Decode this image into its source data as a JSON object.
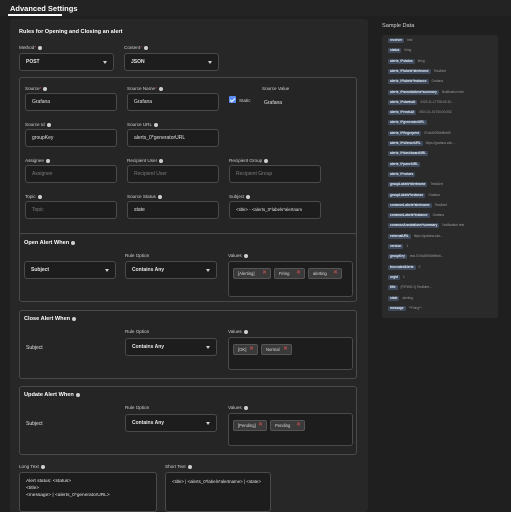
{
  "header": {
    "title": "Advanced Settings"
  },
  "rules": {
    "title": "Rules for Opening and Closing an alert",
    "method_label": "Method",
    "method_value": "POST",
    "content_label": "Content",
    "content_value": "JSON",
    "source_label": "Source",
    "source_value": "Grafana",
    "source_name_label": "Source Name",
    "source_name_value": "Grafana",
    "static_label": "Static",
    "source_value_label": "Source Value",
    "source_value_value": "Grafana",
    "source_id_label": "Source Id",
    "source_id_value": "groupKey",
    "source_url_label": "Source URL",
    "source_url_value": "alerts_0*generatorURL",
    "assignee_label": "Assignee",
    "assignee_placeholder": "Assignee",
    "recipient_user_label": "Recipient User",
    "recipient_user_placeholder": "Recipient User",
    "recipient_group_label": "Recipient Group",
    "recipient_group_placeholder": "Recipient Group",
    "topic_label": "Topic",
    "topic_placeholder": "Topic",
    "source_status_label": "Source Status",
    "source_status_value": "state",
    "subject_label": "Subject",
    "subject_value": "<title> - <alerts_0*labels*alertnam"
  },
  "open_alert": {
    "title": "Open Alert When",
    "field_value": "Subject",
    "rule_option_label": "Rule Option",
    "rule_option_value": "Contains Any",
    "values_label": "Values",
    "values": [
      "[Alerting]",
      "Firing",
      "alerting"
    ]
  },
  "close_alert": {
    "title": "Close Alert When",
    "field_value": "Subject",
    "rule_option_label": "Rule Option",
    "rule_option_value": "Contains Any",
    "values_label": "Values",
    "values": [
      "[OK]",
      "Normal"
    ]
  },
  "update_alert": {
    "title": "Update Alert When",
    "field_value": "Subject",
    "rule_option_label": "Rule Option",
    "rule_option_value": "Contains Any",
    "values_label": "Values",
    "values": [
      "[Pending]",
      "Pending"
    ]
  },
  "long_text": {
    "label": "Long Text",
    "value": "Alert status: <status>\n<title>\n<message> | <alerts_0*generatorURL>"
  },
  "short_text": {
    "label": "Short Text",
    "value": "<title> | <alerts_0*labels*alertname> | <state>"
  },
  "sample_data": {
    "title": "Sample Data",
    "rows": [
      {
        "key": "receiver",
        "value": "test"
      },
      {
        "key": "status",
        "value": "firing"
      },
      {
        "key": "alerts_0*status",
        "value": "firing"
      },
      {
        "key": "alerts_0*labels*alertname",
        "value": "TestAlert"
      },
      {
        "key": "alerts_0*labels*instance",
        "value": "Grafana"
      },
      {
        "key": "alerts_0*annotations*summary",
        "value": "Notification test"
      },
      {
        "key": "alerts_0*startsAt",
        "value": "2023-11-17T08:03:30..."
      },
      {
        "key": "alerts_0*endsAt",
        "value": "0001-01-01T00:00:00Z"
      },
      {
        "key": "alerts_0*generatorURL",
        "value": ""
      },
      {
        "key": "alerts_0*fingerprint",
        "value": "57c6d9296b9bb65"
      },
      {
        "key": "alerts_0*silenceURL",
        "value": "https://grafana.abc..."
      },
      {
        "key": "alerts_0*dashboardURL",
        "value": ""
      },
      {
        "key": "alerts_0*panelURL",
        "value": ""
      },
      {
        "key": "alerts_0*values",
        "value": ""
      },
      {
        "key": "groupLabels*alertname",
        "value": "TestAlert"
      },
      {
        "key": "groupLabels*instance",
        "value": "Grafana"
      },
      {
        "key": "commonLabels*alertname",
        "value": "TestAlert"
      },
      {
        "key": "commonLabels*instance",
        "value": "Grafana"
      },
      {
        "key": "commonAnnotations*summary",
        "value": "Notification test"
      },
      {
        "key": "externalURL",
        "value": "https://grafana.abc..."
      },
      {
        "key": "version",
        "value": "1"
      },
      {
        "key": "groupKey",
        "value": "test-57c6d9296b9bb6..."
      },
      {
        "key": "truncatedAlerts",
        "value": "0"
      },
      {
        "key": "orgId",
        "value": "1"
      },
      {
        "key": "title",
        "value": "[FIRING:1] TestAlert..."
      },
      {
        "key": "state",
        "value": "alerting"
      },
      {
        "key": "message",
        "value": "**Firing**"
      }
    ]
  }
}
